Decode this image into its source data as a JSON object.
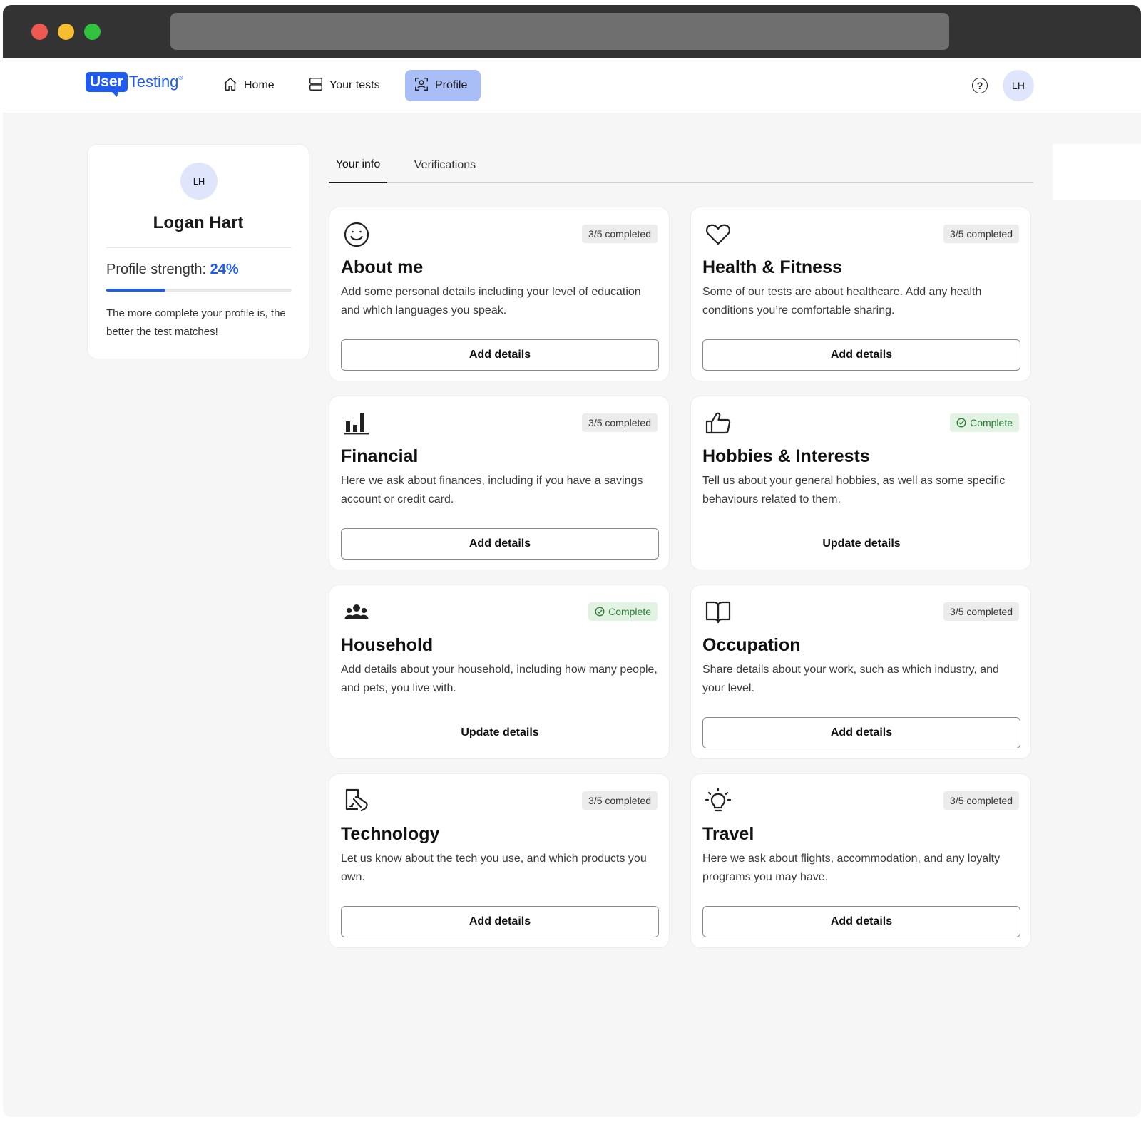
{
  "nav": {
    "logo_user": "User",
    "logo_testing": "Testing",
    "logo_tm": "®",
    "items": [
      {
        "label": "Home",
        "icon": "home-icon"
      },
      {
        "label": "Your tests",
        "icon": "tests-icon"
      },
      {
        "label": "Profile",
        "icon": "profile-icon",
        "active": true
      }
    ],
    "help_icon": "?",
    "avatar_initials": "LH"
  },
  "profile": {
    "avatar_initials": "LH",
    "name": "Logan Hart",
    "strength_label": "Profile strength:",
    "strength_value": "24%",
    "strength_fraction": 0.24,
    "note": "The more complete your profile is, the better the test matches!"
  },
  "tabs": [
    {
      "label": "Your info",
      "active": true
    },
    {
      "label": "Verifications",
      "active": false
    }
  ],
  "categories": [
    {
      "title": "About me",
      "status": "3/5 completed",
      "desc": "Add some personal details including your level of education and which languages you speak.",
      "action": "Add details",
      "icon": "smiley-icon"
    },
    {
      "title": "Health & Fitness",
      "status": "3/5 completed",
      "desc": "Some of our tests are about healthcare. Add any health conditions you’re comfortable sharing.",
      "action": "Add details",
      "icon": "heart-icon"
    },
    {
      "title": "Financial",
      "status": "3/5 completed",
      "desc": "Here we ask about finances, including if you have a savings account or credit card.",
      "action": "Add details",
      "icon": "bar-chart-icon"
    },
    {
      "title": "Hobbies & Interests",
      "status": "Complete",
      "desc": "Tell us about your general hobbies, as well as some specific behaviours related to them.",
      "action": "Update details",
      "icon": "thumbs-up-icon"
    },
    {
      "title": "Household",
      "status": "Complete",
      "desc": "Add details about your household, including how many people, and pets, you live with.",
      "action": "Update details",
      "icon": "people-icon"
    },
    {
      "title": "Occupation",
      "status": "3/5 completed",
      "desc": "Share details about your work, such as which industry, and your level.",
      "action": "Add details",
      "icon": "book-icon"
    },
    {
      "title": "Technology",
      "status": "3/5 completed",
      "desc": "Let us know about the tech you use, and which products you own.",
      "action": "Add details",
      "icon": "phone-touch-icon"
    },
    {
      "title": "Travel",
      "status": "3/5 completed",
      "desc": "Here we ask about flights, accommodation, and any loyalty programs you may have.",
      "action": "Add details",
      "icon": "lightbulb-icon"
    }
  ],
  "colors": {
    "brand": "#1f5bf0",
    "nav_active_bg": "#a9bdf7",
    "complete_bg": "#e2f3e3",
    "complete_text": "#2f7d3a",
    "partial_bg": "#ececec"
  }
}
